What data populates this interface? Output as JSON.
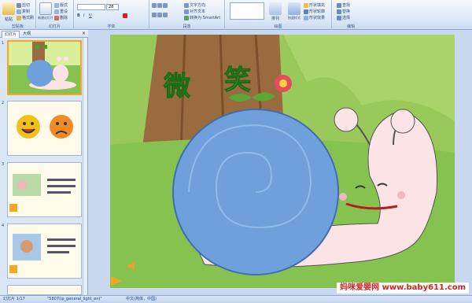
{
  "ribbon": {
    "clipboard": {
      "label": "剪贴板",
      "paste": "粘贴",
      "cut": "剪切",
      "copy": "复制",
      "format_painter": "格式刷"
    },
    "slides": {
      "label": "幻灯片",
      "new_slide": "新建幻灯片",
      "layout": "版式",
      "reset": "重设",
      "delete": "删除"
    },
    "font": {
      "label": "字体",
      "size": "28"
    },
    "paragraph": {
      "label": "段落",
      "text_direction": "文字方向",
      "align_text": "对齐文本",
      "smartart": "转换为 SmartArt"
    },
    "drawing": {
      "label": "绘图",
      "arrange": "排列",
      "quick_styles": "快速样式",
      "shape_fill": "形状填充",
      "shape_outline": "形状轮廓",
      "shape_effects": "形状效果"
    },
    "editing": {
      "label": "编辑",
      "find": "查找",
      "replace": "替换",
      "select": "选择"
    }
  },
  "panel": {
    "tabs": [
      "幻灯片",
      "大纲"
    ],
    "close": "×",
    "slide_numbers": [
      "1",
      "2",
      "3",
      "4"
    ]
  },
  "slide": {
    "title_chars": [
      "微",
      "笑"
    ]
  },
  "status": {
    "slide_info": "幻灯片 1/17",
    "theme": "\"5807(ip_general_light_en)\"",
    "language": "中文(简体，中国)"
  },
  "watermark": "妈咪爱婴网 www.baby611.com",
  "colors": {
    "ribbon_bg": "#dbe7f6",
    "slide_grass": "#7fb945",
    "snail_shell": "#6fa0dc",
    "snail_body": "#fbe3e6",
    "title_green": "#3fa52a"
  }
}
